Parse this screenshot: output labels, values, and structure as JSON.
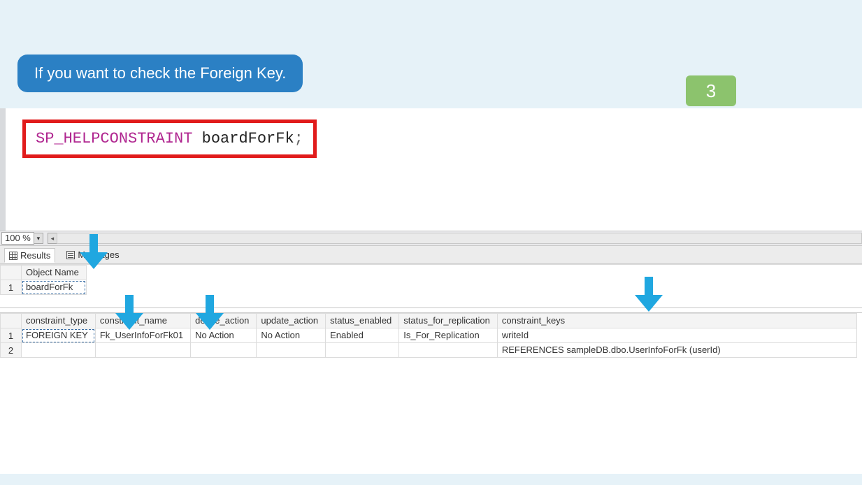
{
  "callout": "If you want to check the Foreign Key.",
  "slide_number": "3",
  "code": {
    "command": "SP_HELPCONSTRAINT",
    "arg": "boardForFk",
    "terminator": ";"
  },
  "zoom": "100 %",
  "tabs": {
    "results": "Results",
    "messages": "Messages"
  },
  "grid1": {
    "header": "Object Name",
    "rownum": "1",
    "value": "boardForFk"
  },
  "grid2": {
    "headers": {
      "constraint_type": "constraint_type",
      "constraint_name": "constraint_name",
      "delete_action": "delete_action",
      "update_action": "update_action",
      "status_enabled": "status_enabled",
      "status_for_replication": "status_for_replication",
      "constraint_keys": "constraint_keys"
    },
    "rows": [
      {
        "num": "1",
        "constraint_type": "FOREIGN KEY",
        "constraint_name": "Fk_UserInfoForFk01",
        "delete_action": "No Action",
        "update_action": "No Action",
        "status_enabled": "Enabled",
        "status_for_replication": "Is_For_Replication",
        "constraint_keys": "writeId"
      },
      {
        "num": "2",
        "constraint_type": "",
        "constraint_name": "",
        "delete_action": "",
        "update_action": "",
        "status_enabled": "",
        "status_for_replication": "",
        "constraint_keys": "REFERENCES sampleDB.dbo.UserInfoForFk (userId)"
      }
    ]
  }
}
